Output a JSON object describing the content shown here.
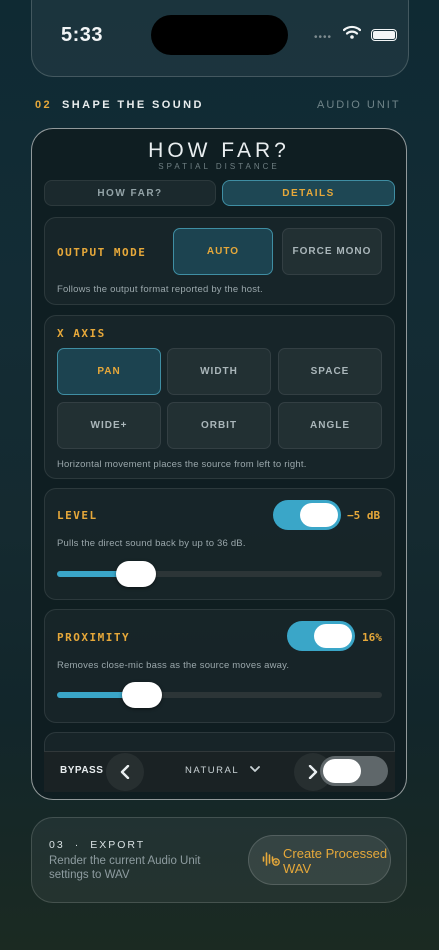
{
  "status_bar": {
    "time": "5:33",
    "signal_dots": "••••"
  },
  "section": {
    "number": "02",
    "title": "SHAPE THE SOUND",
    "right_label": "AUDIO UNIT"
  },
  "panel": {
    "title": "HOW FAR?",
    "subtitle": "SPATIAL DISTANCE",
    "tabs": [
      {
        "label": "HOW FAR?"
      },
      {
        "label": "DETAILS",
        "selected": true
      }
    ],
    "output_mode": {
      "label": "OUTPUT MODE",
      "options": [
        {
          "label": "AUTO",
          "selected": true
        },
        {
          "label": "FORCE MONO"
        }
      ],
      "description": "Follows the output format reported by the host."
    },
    "x_axis": {
      "label": "X AXIS",
      "options": [
        {
          "label": "PAN",
          "selected": true
        },
        {
          "label": "WIDTH"
        },
        {
          "label": "SPACE"
        },
        {
          "label": "WIDE+"
        },
        {
          "label": "ORBIT"
        },
        {
          "label": "ANGLE"
        }
      ],
      "description": "Horizontal movement places the source from left to right."
    },
    "level": {
      "label": "LEVEL",
      "enabled": true,
      "value": "−5 dB",
      "description": "Pulls the direct sound back by up to 36 dB.",
      "slider_fraction": 0.18
    },
    "proximity": {
      "label": "PROXIMITY",
      "enabled": true,
      "value": "16%",
      "description": "Removes close-mic bass as the source moves away.",
      "slider_fraction": 0.2
    },
    "bottom_bar": {
      "bypass_label": "BYPASS",
      "preset_name": "NATURAL",
      "bypass_enabled": false
    }
  },
  "export": {
    "number": "03",
    "title": "EXPORT",
    "description": "Render the current Audio Unit settings to WAV",
    "button_label": "Create Processed WAV"
  },
  "colors": {
    "accent": "#e6a83a",
    "toggle_on": "#3aa6c8",
    "selected_bg": "#1c4350"
  }
}
